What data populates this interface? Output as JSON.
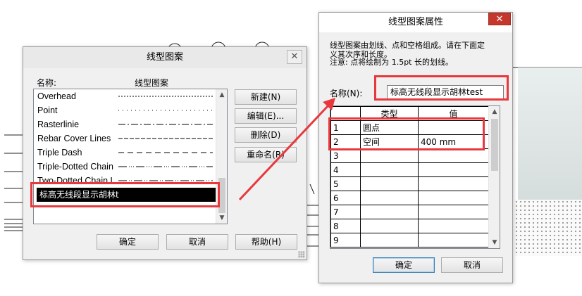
{
  "line_patterns_dialog": {
    "title": "线型图案",
    "close_glyph": "✕",
    "header_name": "名称:",
    "header_pattern": "线型图案",
    "items": [
      {
        "name": "Overhead",
        "dash": "2 2"
      },
      {
        "name": "Point",
        "dash": "1 5"
      },
      {
        "name": "Rasterlinie",
        "dash": "10 3 2 3"
      },
      {
        "name": "Rebar Cover Lines",
        "dash": "6 2"
      },
      {
        "name": "Triple Dash",
        "dash": "8 5"
      },
      {
        "name": "Triple-Dotted Chain",
        "dash": "12 3 1 2 1 2 1 3"
      },
      {
        "name": "Two-Dotted Chain L",
        "dash": "12 3 1 2 1 3"
      }
    ],
    "selected_item": "标高无线段显示胡林t",
    "buttons": {
      "new": "新建(N)",
      "edit": "编辑(E)...",
      "delete": "删除(D)",
      "rename": "重命名(R)",
      "ok": "确定",
      "cancel": "取消",
      "help": "帮助(H)"
    }
  },
  "pattern_properties_dialog": {
    "title": "线型图案属性",
    "close_glyph": "✕",
    "description_line1": "线型图案由划线、点和空格组成。请在下面定",
    "description_line2": "义其次序和长度。",
    "note": "注意: 点将绘制为 1.5pt 长的划线。",
    "name_label": "名称(N):",
    "name_value": "标高无线段显示胡林test",
    "table": {
      "col_type": "类型",
      "col_value": "值",
      "rows": [
        {
          "num": "1",
          "type": "圆点",
          "value": ""
        },
        {
          "num": "2",
          "type": "空间",
          "value": "400 mm"
        },
        {
          "num": "3",
          "type": "",
          "value": ""
        },
        {
          "num": "4",
          "type": "",
          "value": ""
        },
        {
          "num": "5",
          "type": "",
          "value": ""
        },
        {
          "num": "6",
          "type": "",
          "value": ""
        },
        {
          "num": "7",
          "type": "",
          "value": ""
        },
        {
          "num": "8",
          "type": "",
          "value": ""
        },
        {
          "num": "9",
          "type": "",
          "value": ""
        }
      ]
    },
    "buttons": {
      "ok": "确定",
      "cancel": "取消"
    }
  },
  "colors": {
    "highlight": "#e8383d",
    "selection": "#000000"
  }
}
